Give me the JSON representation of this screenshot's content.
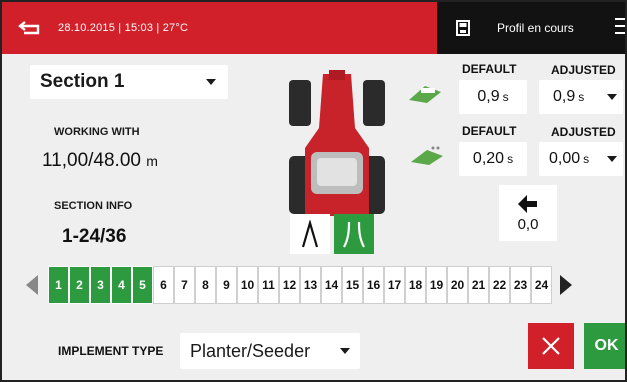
{
  "header": {
    "status": "28.10.2015  |  15:03  |  27°C",
    "profile_label": "Profil en cours"
  },
  "section_select": {
    "value": "Section 1"
  },
  "working_with": {
    "label": "WORKING WITH",
    "value": "11,00/48.00",
    "unit": "m"
  },
  "section_info": {
    "label": "SECTION INFO",
    "value": "1-24/36"
  },
  "timing": {
    "default_header": "DEFAULT",
    "adjusted_header": "ADJUSTED",
    "row1": {
      "default": "0,9",
      "default_unit": "s",
      "adjusted": "0,9",
      "adjusted_unit": "s"
    },
    "row2": {
      "default": "0,20",
      "default_unit": "s",
      "adjusted": "0,00",
      "adjusted_unit": "s"
    }
  },
  "offset": {
    "value": "0,0"
  },
  "sections": {
    "labels": [
      "1",
      "2",
      "3",
      "4",
      "5",
      "6",
      "7",
      "8",
      "9",
      "10",
      "11",
      "12",
      "13",
      "14",
      "15",
      "16",
      "17",
      "18",
      "19",
      "20",
      "21",
      "22",
      "23",
      "24"
    ],
    "active_count": 5
  },
  "implement": {
    "label": "IMPLEMENT TYPE",
    "value": "Planter/Seeder"
  },
  "actions": {
    "ok_label": "OK"
  },
  "colors": {
    "brand_red": "#d2202a",
    "active_green": "#2e9a3f",
    "header_dark": "#121212"
  }
}
